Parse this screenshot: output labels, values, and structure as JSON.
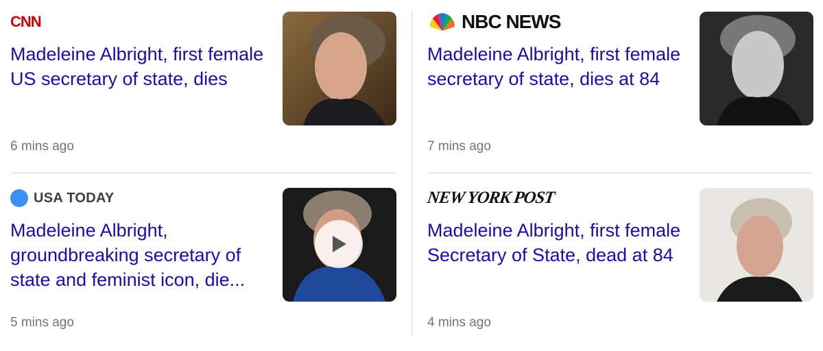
{
  "articles": [
    {
      "source": "CNN",
      "headline": "Madeleine Albright, first female US secretary of state, dies",
      "time": "6 mins ago"
    },
    {
      "source": "NBC NEWS",
      "headline": "Madeleine Albright, first female secretary of state, dies at 84",
      "time": "7 mins ago"
    },
    {
      "source": "USA TODAY",
      "headline": "Madeleine Albright, groundbreaking secretary of state and feminist icon, die...",
      "time": "5 mins ago"
    },
    {
      "source": "NEW YORK POST",
      "headline": "Madeleine Albright, first female Secretary of State, dead at 84",
      "time": "4 mins ago"
    }
  ],
  "colors": {
    "headline": "#1a0dab",
    "time": "#70757a",
    "divider": "#dadce0",
    "cnn": "#cc0000",
    "usa_today": "#3d8ef7"
  },
  "icons": [
    "play-icon"
  ]
}
